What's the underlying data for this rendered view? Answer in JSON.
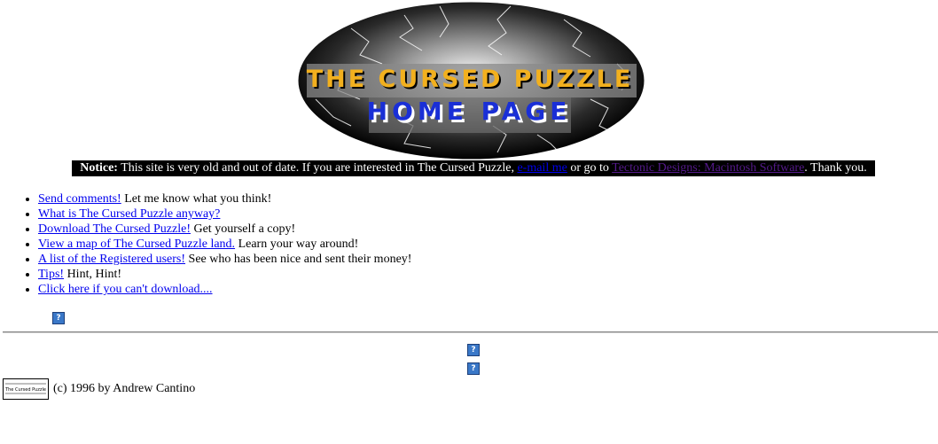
{
  "header": {
    "logo_line1": "THE CURSED PUZZLE",
    "logo_line2": "HOME PAGE",
    "logo_line1_color": "#f2b01e",
    "logo_line2_color": "#1a2fd6"
  },
  "notice": {
    "label": "Notice:",
    "text_before": " This site is very old and out of date. If you are interested in The Cursed Puzzle, ",
    "email_link": "e-mail me",
    "text_middle": " or go to ",
    "tectonic_link": "Tectonic Designs: Macintosh Software",
    "text_after": ". Thank you."
  },
  "menu": {
    "items": [
      {
        "link": "Send comments!",
        "desc": " Let me know what you think!"
      },
      {
        "link": "What is The Cursed Puzzle anyway?",
        "desc": ""
      },
      {
        "link": "Download The Cursed Puzzle!",
        "desc": " Get yourself a copy!"
      },
      {
        "link": "View a map of The Cursed Puzzle land.",
        "desc": " Learn your way around!"
      },
      {
        "link": "A list of the Registered users!",
        "desc": " See who has been nice and sent their money!"
      },
      {
        "link": "Tips!",
        "desc": " Hint, Hint!"
      },
      {
        "link": "Click here if you can't download....",
        "desc": ""
      }
    ]
  },
  "broken_image_glyph": "?",
  "footer": {
    "copyright": "(c) 1996 by Andrew Cantino",
    "mini_logo_text": "The Cursed Puzzle"
  },
  "colors": {
    "link": "#0000ee",
    "visited_link": "#551a8b",
    "notice_bg": "#000000"
  }
}
